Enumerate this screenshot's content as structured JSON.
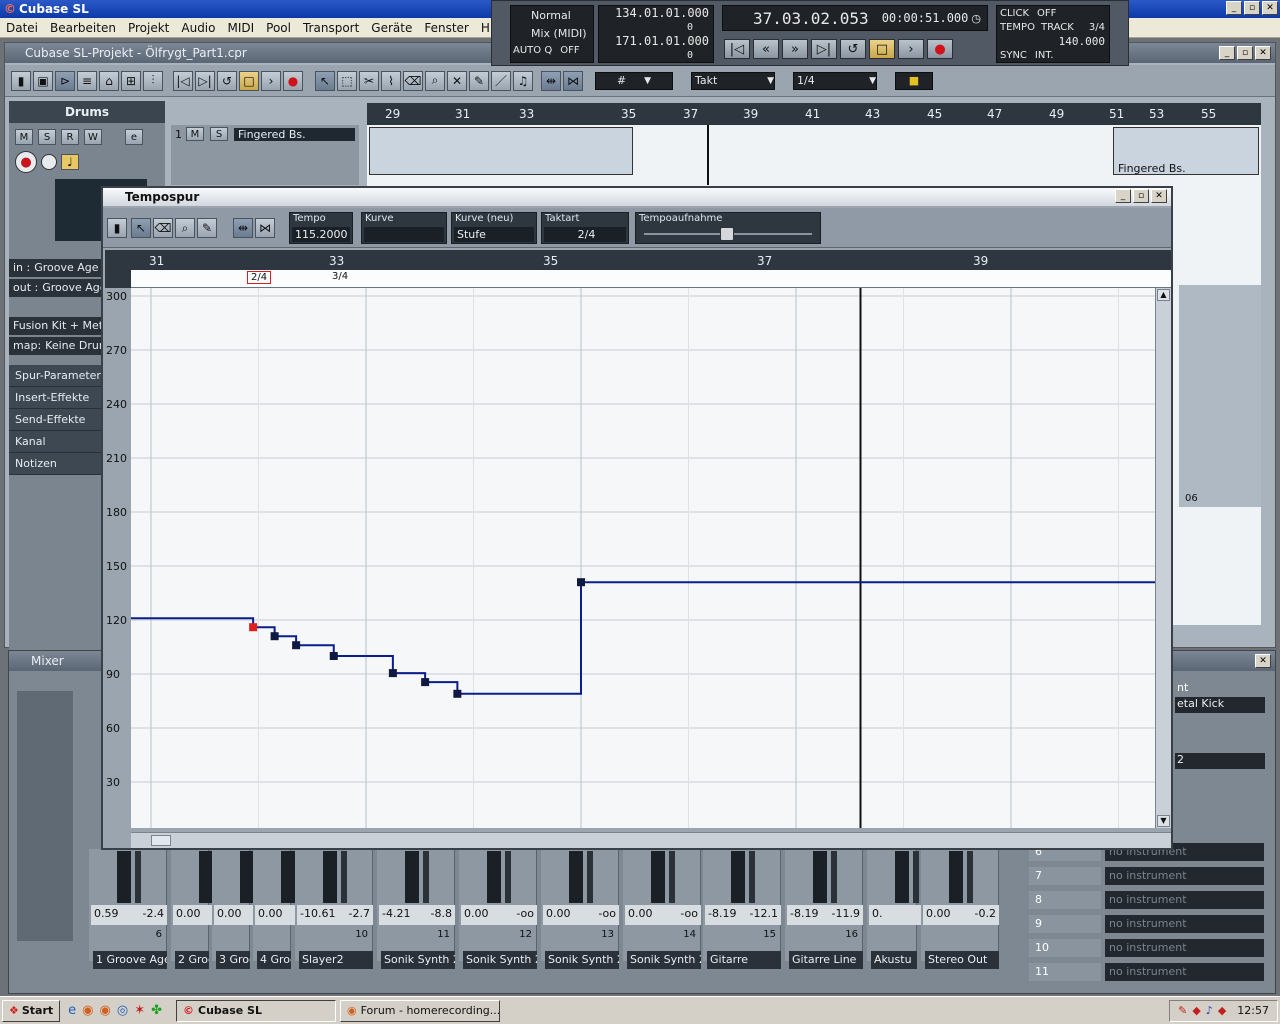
{
  "app": {
    "title": "Cubase SL",
    "min": "_",
    "max": "▫",
    "close": "✕"
  },
  "menu": [
    "Datei",
    "Bearbeiten",
    "Projekt",
    "Audio",
    "MIDI",
    "Pool",
    "Transport",
    "Geräte",
    "Fenster",
    "Hilfe"
  ],
  "transport": {
    "mode": "Normal",
    "mix": "Mix (MIDI)",
    "autoq_label": "AUTO Q",
    "autoq_value": "OFF",
    "left_locator": "134.01.01.000",
    "left_offset": "0",
    "right_locator": "171.01.01.000",
    "right_offset": "0",
    "l_label": "L",
    "r_label": "R",
    "position_bars": "37.03.02.053",
    "position_time": "00:00:51.000",
    "click_label": "CLICK",
    "click_value": "OFF",
    "tempo_label": "TEMPO",
    "track_label": "TRACK",
    "signature": "3/4",
    "tempo_value": "140.000",
    "sync_label": "SYNC",
    "sync_value": "INT."
  },
  "project": {
    "title": "Cubase SL-Projekt - Ölfrygt_Part1.cpr",
    "toolbar": {
      "takt": "Takt",
      "quantize": "1/4"
    },
    "ruler": [
      "29",
      "31",
      "33",
      "35",
      "37",
      "39",
      "41",
      "43",
      "45",
      "47",
      "49",
      "51",
      "53",
      "55"
    ],
    "arrange_event_label": "Fingered Bs.",
    "arrange_event_label2": "06",
    "inspector": {
      "track_name": "Drums",
      "in_label": "in :",
      "in_value": "Groove Age",
      "out_label": "out :",
      "out_value": "Groove Age",
      "kit": "Fusion Kit + Metal",
      "map_label": "map:",
      "map_value": "Keine Drum",
      "sections": [
        "Spur-Parameter",
        "Insert-Effekte",
        "Send-Effekte",
        "Kanal",
        "Notizen"
      ],
      "msrw": [
        "M",
        "S",
        "R",
        "W"
      ],
      "e_label": "e"
    },
    "track": {
      "number": "1",
      "name": "Fingered Bs."
    }
  },
  "tempo_window": {
    "title": "Tempospur",
    "tempo_label": "Tempo",
    "tempo_value": "115.2000",
    "curve_label": "Kurve",
    "curve_value": "",
    "curve_new_label": "Kurve (neu)",
    "curve_new_value": "Stufe",
    "signature_label": "Taktart",
    "signature_value": "2/4",
    "record_label": "Tempoaufnahme",
    "ruler": [
      "31",
      "33",
      "35",
      "37",
      "39"
    ],
    "sig_events": [
      "2/4",
      "3/4"
    ],
    "y_axis": [
      "300",
      "270",
      "240",
      "210",
      "180",
      "150",
      "120",
      "90",
      "60",
      "30"
    ],
    "tempo_points": [
      {
        "bar": 30.05,
        "bpm": 121.0
      },
      {
        "bar": 31.95,
        "bpm": 116.0
      },
      {
        "bar": 32.15,
        "bpm": 111.0
      },
      {
        "bar": 32.35,
        "bpm": 106.0
      },
      {
        "bar": 32.7,
        "bpm": 100.0
      },
      {
        "bar": 33.25,
        "bpm": 90.5
      },
      {
        "bar": 33.55,
        "bpm": 85.5
      },
      {
        "bar": 33.85,
        "bpm": 79.0
      },
      {
        "bar": 35.0,
        "bpm": 141.0
      },
      {
        "bar": 40.7,
        "bpm": 141.0
      }
    ]
  },
  "mixer": {
    "title": "Mixer",
    "strips": [
      {
        "pan": "-2.4",
        "vol": "0.59",
        "num": "6",
        "name": "1 Groove Agen"
      },
      {
        "pan": "",
        "vol": "0.00",
        "num": "",
        "name": "2 Groo"
      },
      {
        "pan": "",
        "vol": "0.00",
        "num": "",
        "name": "3 Groo"
      },
      {
        "pan": "",
        "vol": "0.00",
        "num": "",
        "name": "4 Groo"
      },
      {
        "pan": "-2.7",
        "vol": "-10.61",
        "num": "10",
        "name": "Slayer2"
      },
      {
        "pan": "-8.8",
        "vol": "-4.21",
        "num": "11",
        "name": "Sonik Synth 2"
      },
      {
        "pan": "-oo",
        "vol": "0.00",
        "num": "12",
        "name": "Sonik Synth 2"
      },
      {
        "pan": "-oo",
        "vol": "0.00",
        "num": "13",
        "name": "Sonik Synth 2"
      },
      {
        "pan": "-oo",
        "vol": "0.00",
        "num": "14",
        "name": "Sonik Synth 2"
      },
      {
        "pan": "-12.1",
        "vol": "-8.19",
        "num": "15",
        "name": "Gitarre"
      },
      {
        "pan": "-11.9",
        "vol": "-8.19",
        "num": "16",
        "name": "Gitarre Line"
      },
      {
        "pan": "",
        "vol": "0.",
        "num": "",
        "name": "Akustu"
      },
      {
        "pan": "-0.2",
        "vol": "0.00",
        "num": "",
        "name": "Stereo Out"
      }
    ],
    "instruments": [
      {
        "num": "6",
        "name": "no instrument"
      },
      {
        "num": "7",
        "name": "no instrument"
      },
      {
        "num": "8",
        "name": "no instrument"
      },
      {
        "num": "9",
        "name": "no instrument"
      },
      {
        "num": "10",
        "name": "no instrument"
      },
      {
        "num": "11",
        "name": "no instrument"
      }
    ],
    "right_top": {
      "label1": "nt",
      "label2": "etal Kick",
      "label3": "2"
    }
  },
  "taskbar": {
    "start": "Start",
    "tasks": [
      "Cubase SL",
      "Forum - homerecording...."
    ],
    "clock": "12:57"
  }
}
